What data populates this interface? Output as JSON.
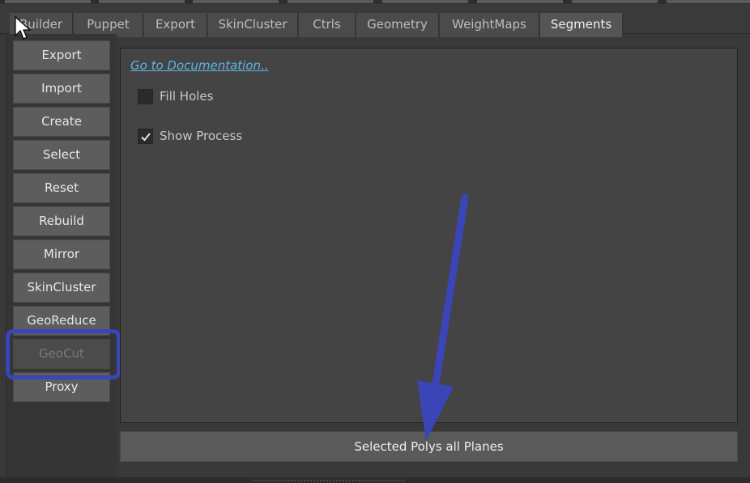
{
  "tabs": [
    {
      "label": "Builder",
      "active": false
    },
    {
      "label": "Puppet",
      "active": false
    },
    {
      "label": "Export",
      "active": false
    },
    {
      "label": "SkinCluster",
      "active": false
    },
    {
      "label": "Ctrls",
      "active": false
    },
    {
      "label": "Geometry",
      "active": false
    },
    {
      "label": "WeightMaps",
      "active": false
    },
    {
      "label": "Segments",
      "active": true
    }
  ],
  "sidebar": {
    "buttons": [
      {
        "label": "Export",
        "enabled": true
      },
      {
        "label": "Import",
        "enabled": true
      },
      {
        "label": "Create",
        "enabled": true
      },
      {
        "label": "Select",
        "enabled": true
      },
      {
        "label": "Reset",
        "enabled": true
      },
      {
        "label": "Rebuild",
        "enabled": true
      },
      {
        "label": "Mirror",
        "enabled": true
      },
      {
        "label": "SkinCluster",
        "enabled": true
      },
      {
        "label": "GeoReduce",
        "enabled": true
      },
      {
        "label": "GeoCut",
        "enabled": false
      },
      {
        "label": "Proxy",
        "enabled": true
      }
    ]
  },
  "main": {
    "doc_link": "Go to Documentation..",
    "options": [
      {
        "label": "Fill Holes",
        "checked": false
      },
      {
        "label": "Show Process",
        "checked": true
      }
    ],
    "action_button": "Selected Polys all Planes"
  },
  "annotations": {
    "highlight_color": "#3a45b8",
    "arrow_color": "#3a45b8"
  },
  "icons": {
    "checkmark": "checkmark-icon",
    "cursor": "mouse-cursor-icon",
    "arrow": "annotation-arrow-icon"
  }
}
